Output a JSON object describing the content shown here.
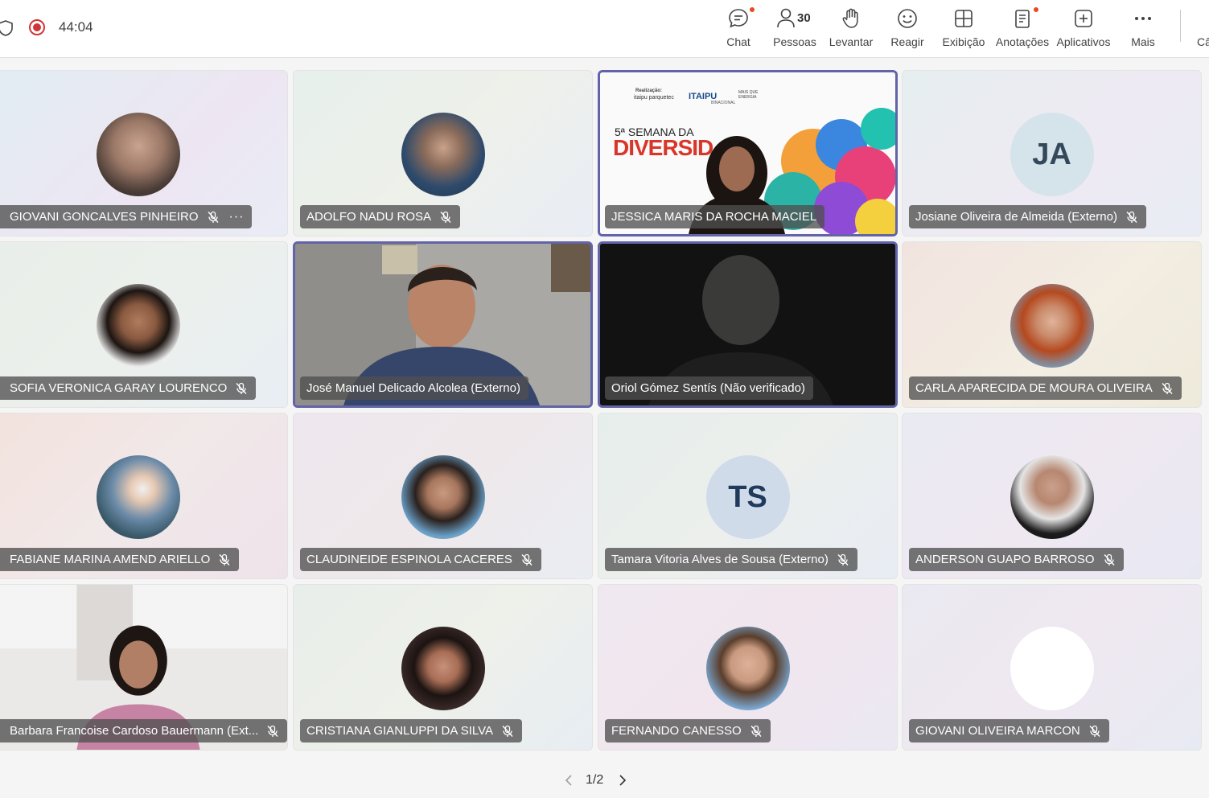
{
  "toolbar": {
    "timer": "44:04",
    "buttons": {
      "chat": "Chat",
      "people": "Pessoas",
      "people_count": "30",
      "raise": "Levantar",
      "react": "Reagir",
      "view": "Exibição",
      "notes": "Anotações",
      "apps": "Aplicativos",
      "more": "Mais",
      "cut": "Câ"
    }
  },
  "participants": [
    {
      "name": "GIOVANI GONCALVES PINHEIRO",
      "muted": true,
      "more": "···"
    },
    {
      "name": "ADOLFO NADU ROSA",
      "muted": true
    },
    {
      "name": "JESSICA MARIS DA ROCHA MACIEL",
      "muted": false,
      "banner": {
        "small1": "Realização:",
        "logo1": "itaipu parquetec",
        "logo2": "ITAIPU",
        "logo2_sub": "BINACIONAL",
        "logo3": "MAIS QUE ENERGIA",
        "line1": "5ª SEMANA DA",
        "line2": "DIVERSID"
      }
    },
    {
      "name": "Josiane Oliveira de Almeida (Externo)",
      "muted": true,
      "initials": "JA"
    },
    {
      "name": "SOFIA VERONICA GARAY LOURENCO",
      "muted": true
    },
    {
      "name": "José Manuel Delicado Alcolea (Externo)",
      "muted": false
    },
    {
      "name": "Oriol Gómez Sentís (Não verificado)",
      "muted": false
    },
    {
      "name": "CARLA APARECIDA DE MOURA OLIVEIRA",
      "muted": true
    },
    {
      "name": "FABIANE MARINA AMEND ARIELLO",
      "muted": true
    },
    {
      "name": "CLAUDINEIDE ESPINOLA CACERES",
      "muted": true
    },
    {
      "name": "Tamara Vitoria Alves de Sousa (Externo)",
      "muted": true,
      "initials": "TS"
    },
    {
      "name": "ANDERSON GUAPO BARROSO",
      "muted": true
    },
    {
      "name": "Barbara Francoise Cardoso Bauermann (Ext...",
      "muted": true
    },
    {
      "name": "CRISTIANA GIANLUPPI DA SILVA",
      "muted": true
    },
    {
      "name": "FERNANDO CANESSO",
      "muted": true
    },
    {
      "name": "GIOVANI OLIVEIRA MARCON",
      "muted": true
    }
  ],
  "pager": {
    "text": "1/2"
  },
  "colors": {
    "accent": "#6264a7",
    "recording": "#d13438",
    "notification": "#e8491d"
  }
}
